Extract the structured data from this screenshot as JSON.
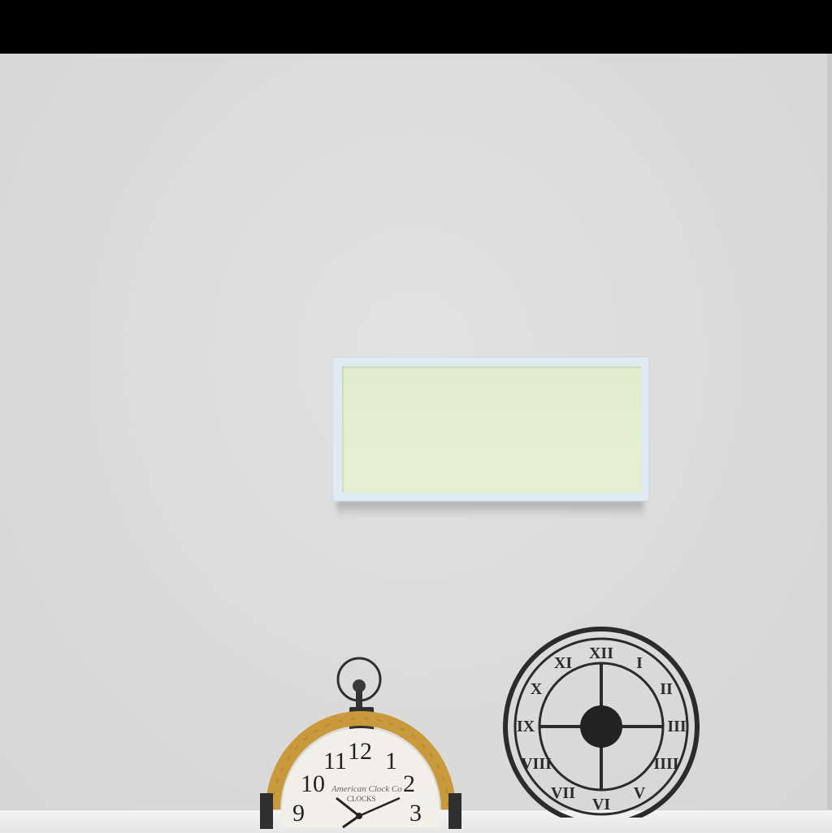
{
  "scene": {
    "description_labels": {
      "left_clock_brand_script": "American Clock Co",
      "left_clock_brand": "CLOCKS"
    },
    "left_clock": {
      "numerals": [
        "12",
        "1",
        "2",
        "3",
        "9",
        "10",
        "11"
      ]
    },
    "right_clock": {
      "numerals": [
        "XII",
        "I",
        "II",
        "III",
        "IIII",
        "V",
        "VI",
        "VII",
        "VIII",
        "IX",
        "X",
        "XI"
      ]
    },
    "colors": {
      "wall": "#dcdcdc",
      "frame": "#dfeaf3",
      "mat": "#e4efcf",
      "wood": "#c99a3c",
      "metal": "#2b2b2b"
    }
  }
}
